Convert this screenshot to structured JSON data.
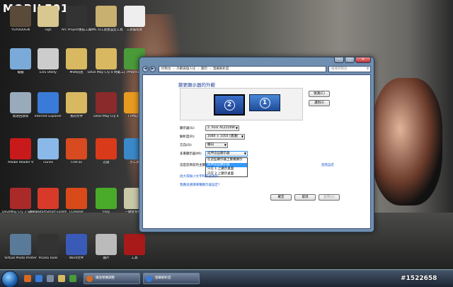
{
  "branding": {
    "logo": "MOBILE01",
    "watermark": "#1522658"
  },
  "desktop_icons": [
    {
      "label": "YGYODOGN",
      "color": "#5a4a3a"
    },
    {
      "label": "sign",
      "color": "#d8c890"
    },
    {
      "label": "Arc Project後技工具",
      "color": "#333"
    },
    {
      "label": "DMC-O工具營設定工具",
      "color": "#c8b070"
    },
    {
      "label": "工具幫程式",
      "color": "#eee"
    },
    {
      "label": "電腦",
      "color": "#7aaad8"
    },
    {
      "label": "EOS Utility",
      "color": "#ccc"
    },
    {
      "label": "MSN訊息",
      "color": "#d8b860"
    },
    {
      "label": "Devil May Cry 4 閃電工具",
      "color": "#d8b860"
    },
    {
      "label": "PPStream",
      "color": "#4a9a3a"
    },
    {
      "label": "資源回收筒",
      "color": "#9ab"
    },
    {
      "label": "Internet Explorer",
      "color": "#3a7ad8"
    },
    {
      "label": "我的文件",
      "color": "#d8b860"
    },
    {
      "label": "Devil May Cry 4",
      "color": "#8a2a2a"
    },
    {
      "label": "TTPlayer",
      "color": "#e89a20"
    },
    {
      "label": "Adobe Reader 9",
      "color": "#c81a1a"
    },
    {
      "label": "iTunes",
      "color": "#8ab8e8"
    },
    {
      "label": "FireFox",
      "color": "#d84a20"
    },
    {
      "label": "迅雷",
      "color": "#d83a1a"
    },
    {
      "label": "小工具",
      "color": "#3a88c8"
    },
    {
      "label": "DevilMay Cry 3 Special Edition",
      "color": "#aa2a2a"
    },
    {
      "label": "Nero StartSmart Essentials",
      "color": "#d83a2a"
    },
    {
      "label": "CCleaner",
      "color": "#d84a1a"
    },
    {
      "label": "Foxy",
      "color": "#4aaa2a"
    },
    {
      "label": "一鍵從系統中",
      "color": "#c8c8a8"
    },
    {
      "label": "Virtual Photo Printer",
      "color": "#5a7a9a"
    },
    {
      "label": "Picasa Tools",
      "color": "#333"
    },
    {
      "label": "Word文件",
      "color": "#3a5ab8"
    },
    {
      "label": "圖片",
      "color": "#bbb"
    },
    {
      "label": "工具",
      "color": "#a81a1a"
    }
  ],
  "window": {
    "title_buttons": {
      "minimize": "–",
      "maximize": "□",
      "close": "✕"
    },
    "nav": {
      "back": "◀",
      "forward": "▶"
    },
    "breadcrumb": [
      "控制台",
      "外觀與個人化",
      "顯示",
      "螢幕解析度"
    ],
    "search_placeholder": "搜尋控制台",
    "heading": "變更顯示器的外觀",
    "monitors": {
      "primary": "2",
      "secondary": "1"
    },
    "side_buttons": {
      "detect": "偵測(C)",
      "identify": "識別(I)"
    },
    "fields": {
      "display_label": "顯示器(S):",
      "display_value": "2. Acer AL2216W",
      "resolution_label": "解析度(R):",
      "resolution_value": "1680 × 1050 (建議)",
      "orientation_label": "方向(O):",
      "orientation_value": "橫向",
      "multi_label": "多重顯示器(M):",
      "multi_value": "延伸這些顯示器"
    },
    "dropdown_options": [
      "在這些顯示器上重複顯示",
      "延伸這些顯示器",
      "只在 1 上顯示桌面",
      "只在 2 上顯示桌面"
    ],
    "selected_option_index": 1,
    "main_display_text": "這是您目前的主顯示器",
    "advanced_link": "進階設定",
    "links": [
      "放大或縮小文字和其他項目",
      "我應該選擇哪種顯示器設定?"
    ],
    "buttons": {
      "ok": "確定",
      "cancel": "取消",
      "apply": "套用(A)"
    }
  },
  "taskbar": {
    "tasks": [
      {
        "label": "播放營機調整",
        "color": "#d86a20"
      },
      {
        "label": "螢幕解析度",
        "color": "#3a7ad8"
      }
    ]
  }
}
